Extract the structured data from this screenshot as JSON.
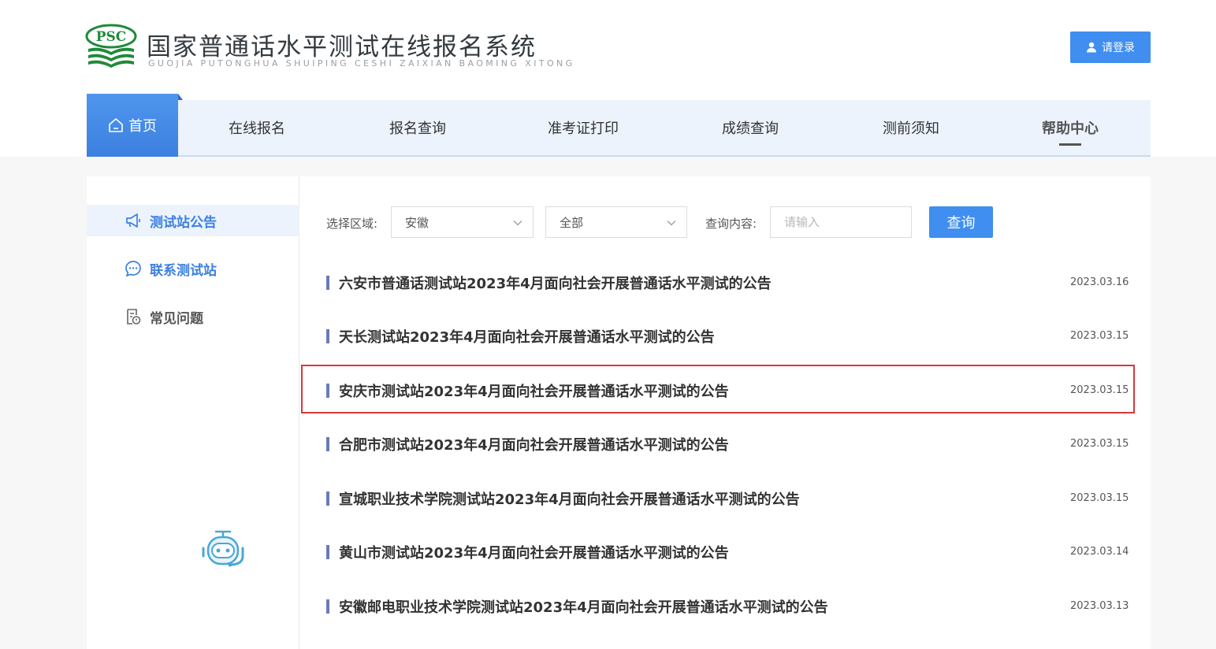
{
  "brand": {
    "title": "国家普通话水平测试在线报名系统",
    "subtitle": "GUOJIA PUTONGHUA SHUIPING CESHI ZAIXIAN BAOMING XITONG",
    "logo_text": "PSC",
    "logo_color": "#1f8a3b"
  },
  "header": {
    "login_label": "请登录",
    "login_icon": "user-icon"
  },
  "nav": {
    "home": "首页",
    "items": [
      "在线报名",
      "报名查询",
      "准考证打印",
      "成绩查询",
      "测前须知"
    ],
    "active": "帮助中心"
  },
  "sidebar": {
    "items": [
      {
        "label": "测试站公告",
        "icon": "megaphone-icon"
      },
      {
        "label": "联系测试站",
        "icon": "chat-icon"
      },
      {
        "label": "常见问题",
        "icon": "faq-document-icon"
      }
    ]
  },
  "filters": {
    "region_label": "选择区域:",
    "region_value": "安徽",
    "type_value": "全部",
    "query_label": "查询内容:",
    "query_placeholder": "请输入",
    "search_label": "查询"
  },
  "notices": [
    {
      "title": "六安市普通话测试站2023年4月面向社会开展普通话水平测试的公告",
      "date": "2023.03.16"
    },
    {
      "title": "天长测试站2023年4月面向社会开展普通话水平测试的公告",
      "date": "2023.03.15"
    },
    {
      "title": "安庆市测试站2023年4月面向社会开展普通话水平测试的公告",
      "date": "2023.03.15"
    },
    {
      "title": "合肥市测试站2023年4月面向社会开展普通话水平测试的公告",
      "date": "2023.03.15"
    },
    {
      "title": "宣城职业技术学院测试站2023年4月面向社会开展普通话水平测试的公告",
      "date": "2023.03.15"
    },
    {
      "title": "黄山市测试站2023年4月面向社会开展普通话水平测试的公告",
      "date": "2023.03.14"
    },
    {
      "title": "安徽邮电职业技术学院测试站2023年4月面向社会开展普通话水平测试的公告",
      "date": "2023.03.13"
    }
  ],
  "colors": {
    "accent": "#3f8ef0",
    "highlight_border": "#d9363e",
    "nav_bg": "#ecf3fc"
  }
}
